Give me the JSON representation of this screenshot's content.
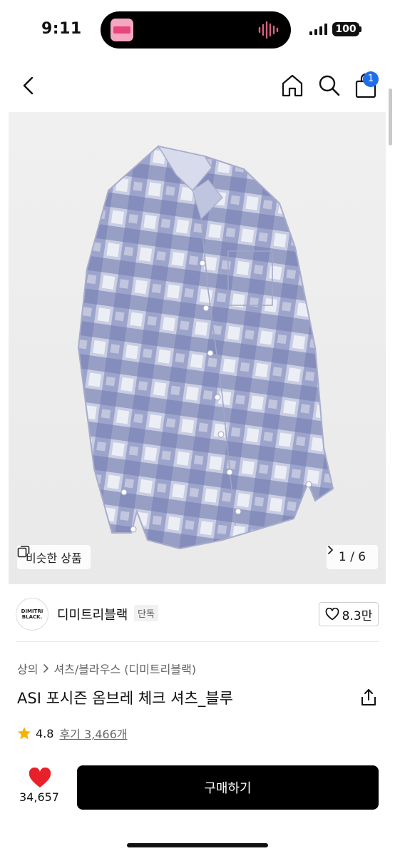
{
  "status_bar": {
    "time": "9:11",
    "battery": "100"
  },
  "nav": {
    "cart_count": "1"
  },
  "gallery": {
    "similar_label": "비슷한 상품",
    "pager": "1 / 6"
  },
  "brand": {
    "logo_line1": "DIMITRI",
    "logo_line2": "BLACK.",
    "name": "디미트리블랙",
    "tag": "단독",
    "likes": "8.3만"
  },
  "product": {
    "breadcrumb": [
      "상의",
      "셔츠/블라우스 (디미트리블랙)"
    ],
    "title": "ASI 포시즌 옴브레 체크 셔츠_블루",
    "rating": "4.8",
    "reviews": "후기 3,466개"
  },
  "bottom": {
    "wish_count": "34,657",
    "buy_label": "구매하기"
  },
  "colors": {
    "accent": "#1f6feb",
    "heart": "#e8202a",
    "star": "#f5b400",
    "shirt": "#9aa3c8"
  },
  "icons": [
    "back-icon",
    "home-icon",
    "search-icon",
    "cart-icon",
    "similar-icon",
    "chevron-right-icon",
    "heart-outline-icon",
    "share-icon",
    "star-icon",
    "heart-filled-icon"
  ]
}
